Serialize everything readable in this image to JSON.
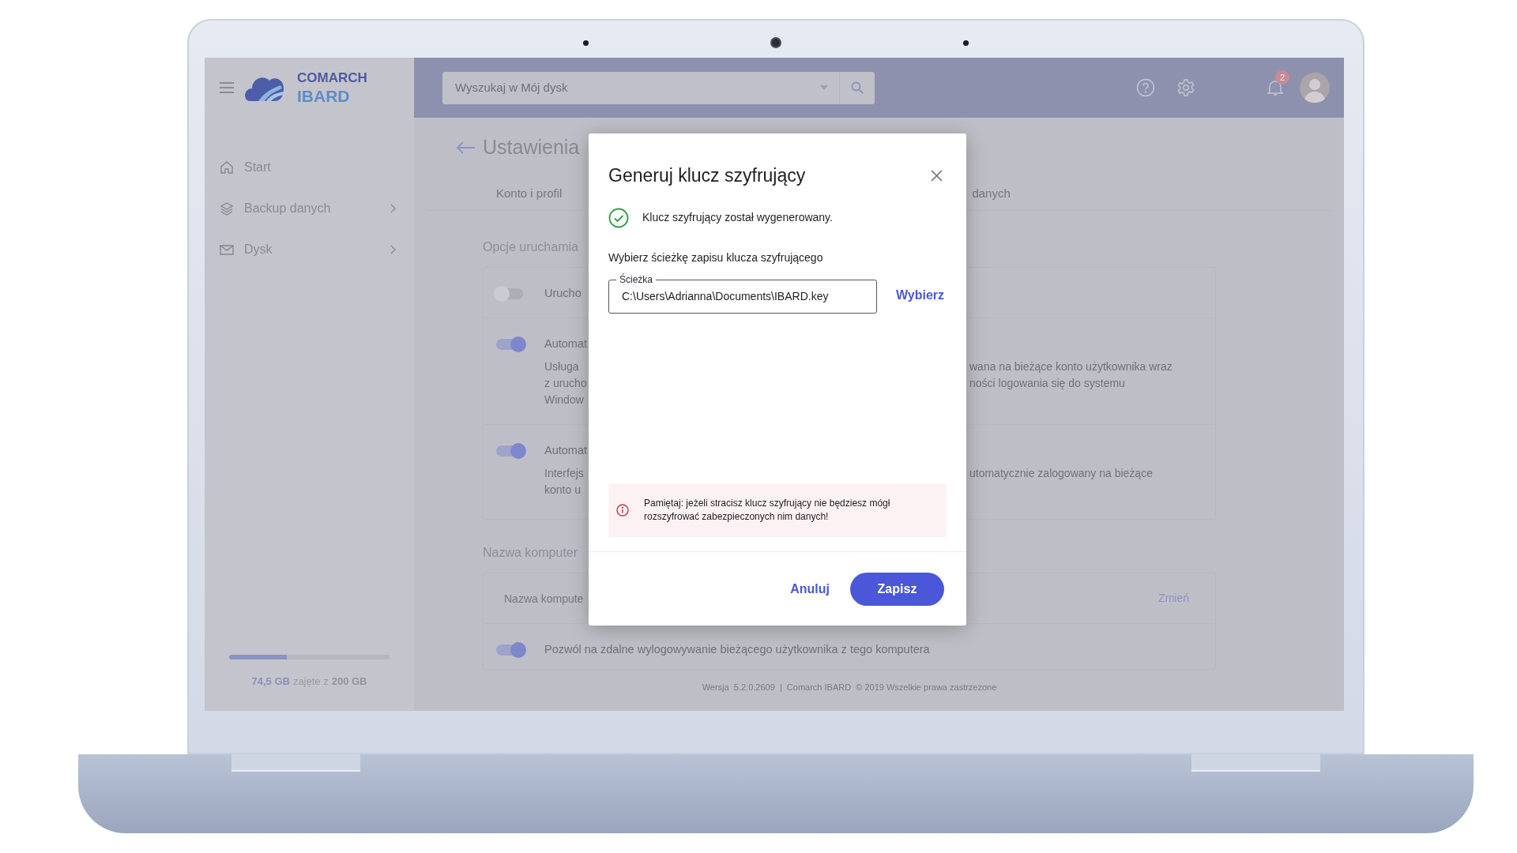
{
  "sidebar": {
    "logo": {
      "line1": "COMARCH",
      "line2": "IBARD"
    },
    "items": [
      {
        "label": "Start",
        "kind": "home",
        "expandable": false
      },
      {
        "label": "Backup danych",
        "kind": "layers",
        "expandable": true
      },
      {
        "label": "Dysk",
        "kind": "inbox",
        "expandable": true
      }
    ],
    "storage": {
      "level": 0.36,
      "used": "74,5 GB",
      "between": "zajęte z",
      "total": "200 GB"
    }
  },
  "header": {
    "search": {
      "placeholder": "Wyszukaj w Mój dysk"
    },
    "notifications": {
      "count": "2"
    }
  },
  "page": {
    "title": "Ustawienia",
    "tabs": [
      {
        "label": "Konto i profil",
        "selected": false
      },
      {
        "label": "danych",
        "selected": false
      }
    ],
    "sections": [
      {
        "heading": "Opcje uruchamia",
        "settings": [
          {
            "on": false,
            "label": "Urucho"
          },
          {
            "on": true,
            "label": "Automat",
            "left_lines": [
              "Usługa",
              "z urucho",
              "Window"
            ],
            "right_lines": [
              "wana na bieżące konto użytkownika wraz",
              "ności logowania się do systemu"
            ]
          },
          {
            "on": true,
            "label": "Automat",
            "left_lines": [
              "Interfejs",
              "konto u"
            ],
            "right_lines": [
              "utomatycznie zalogowany na bieżące"
            ]
          }
        ]
      },
      {
        "heading": "Nazwa komputer",
        "name_field": {
          "placeholder": "Nazwa kompute",
          "action": "Zmień"
        },
        "settings": [
          {
            "on": true,
            "label": "Pozwól na zdalne wylogowywanie bieżącego użytkownika z tego komputera"
          }
        ]
      }
    ],
    "footer": "Wersja  5.2.0.2609  |  Comarch IBARD  © 2019 Wszelkie prawa zastrzeżone"
  },
  "dialog": {
    "title": "Generuj klucz szyfrujący",
    "success": "Klucz szyfrujący został wygenerowany.",
    "prompt": "Wybierz ścieżkę zapisu klucza szyfrującego",
    "path_field": {
      "label": "Ścieżka",
      "value": "C:\\Users\\Adrianna\\Documents\\IBARD.key"
    },
    "choose": "Wybierz",
    "warning": "Pamiętaj: jeżeli stracisz klucz szyfrujący nie będziesz mógł rozszyfrować zabezpieczonych nim danych!",
    "cancel": "Anuluj",
    "save": "Zapisz"
  }
}
